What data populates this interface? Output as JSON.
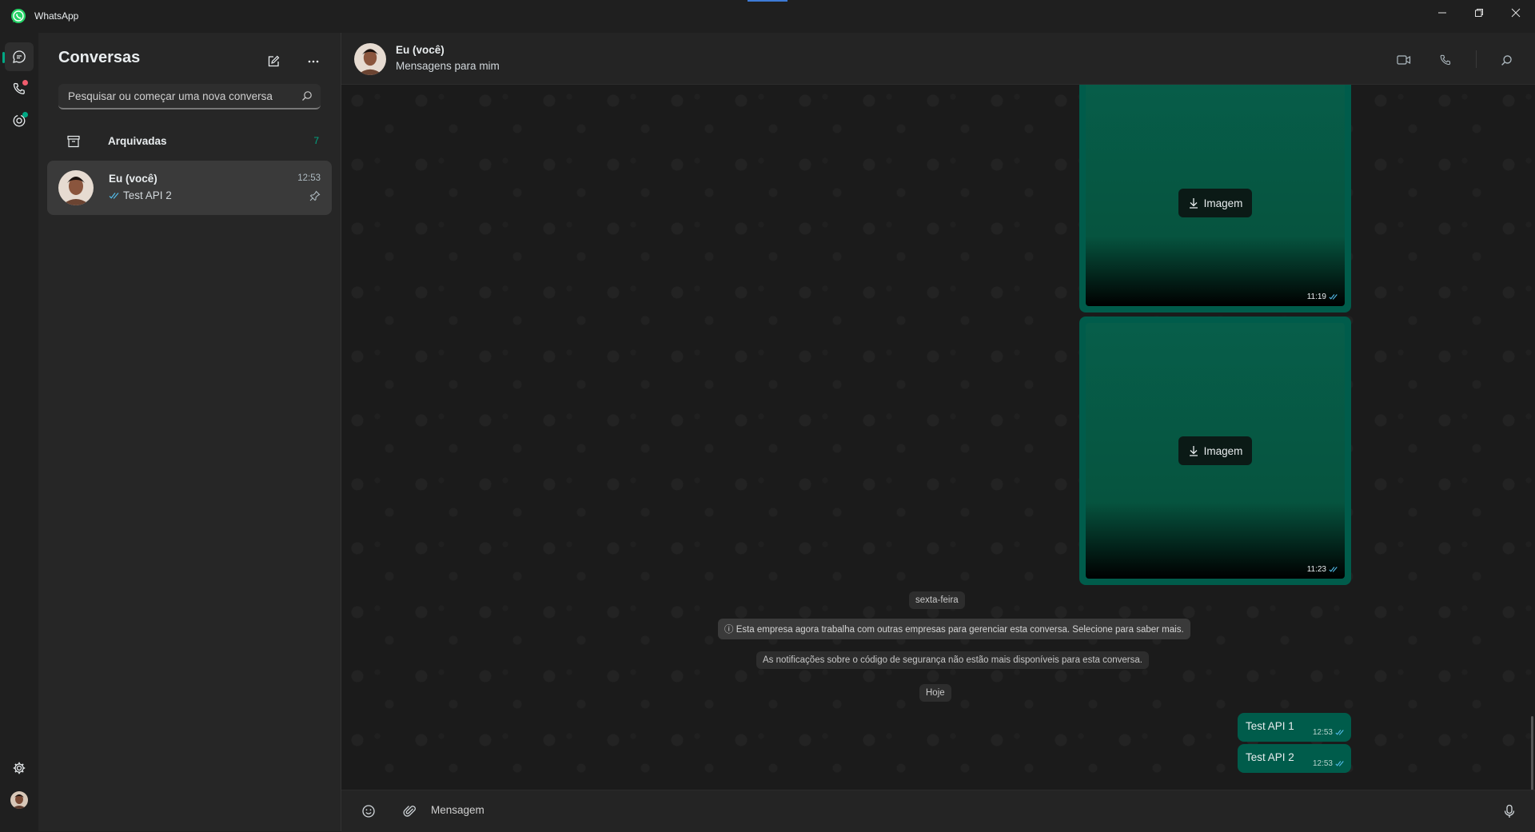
{
  "app": {
    "title": "WhatsApp",
    "accent": "#00a884",
    "bubble_color": "#005c4b"
  },
  "sidebar": {
    "heading": "Conversas",
    "search_placeholder": "Pesquisar ou começar uma nova conversa",
    "archived": {
      "label": "Arquivadas",
      "count": "7"
    },
    "chats": [
      {
        "name": "Eu (você)",
        "time": "12:53",
        "preview": "Test API 2",
        "pinned": true
      }
    ]
  },
  "chat": {
    "name": "Eu (você)",
    "subtitle": "Mensagens para mim",
    "messages": {
      "images": [
        {
          "label": "Imagem",
          "time": "11:19"
        },
        {
          "label": "Imagem",
          "time": "11:23"
        }
      ],
      "date_sexta": "sexta-feira",
      "notice_business": "ⓘ Esta empresa agora trabalha com outras empresas para gerenciar esta conversa. Selecione para saber mais.",
      "notice_security": "As notificações sobre o código de segurança não estão mais disponíveis para esta conversa.",
      "date_hoje": "Hoje",
      "texts": [
        {
          "text": "Test API 1",
          "time": "12:53"
        },
        {
          "text": "Test API 2",
          "time": "12:53"
        }
      ]
    },
    "composer_placeholder": "Mensagem"
  }
}
